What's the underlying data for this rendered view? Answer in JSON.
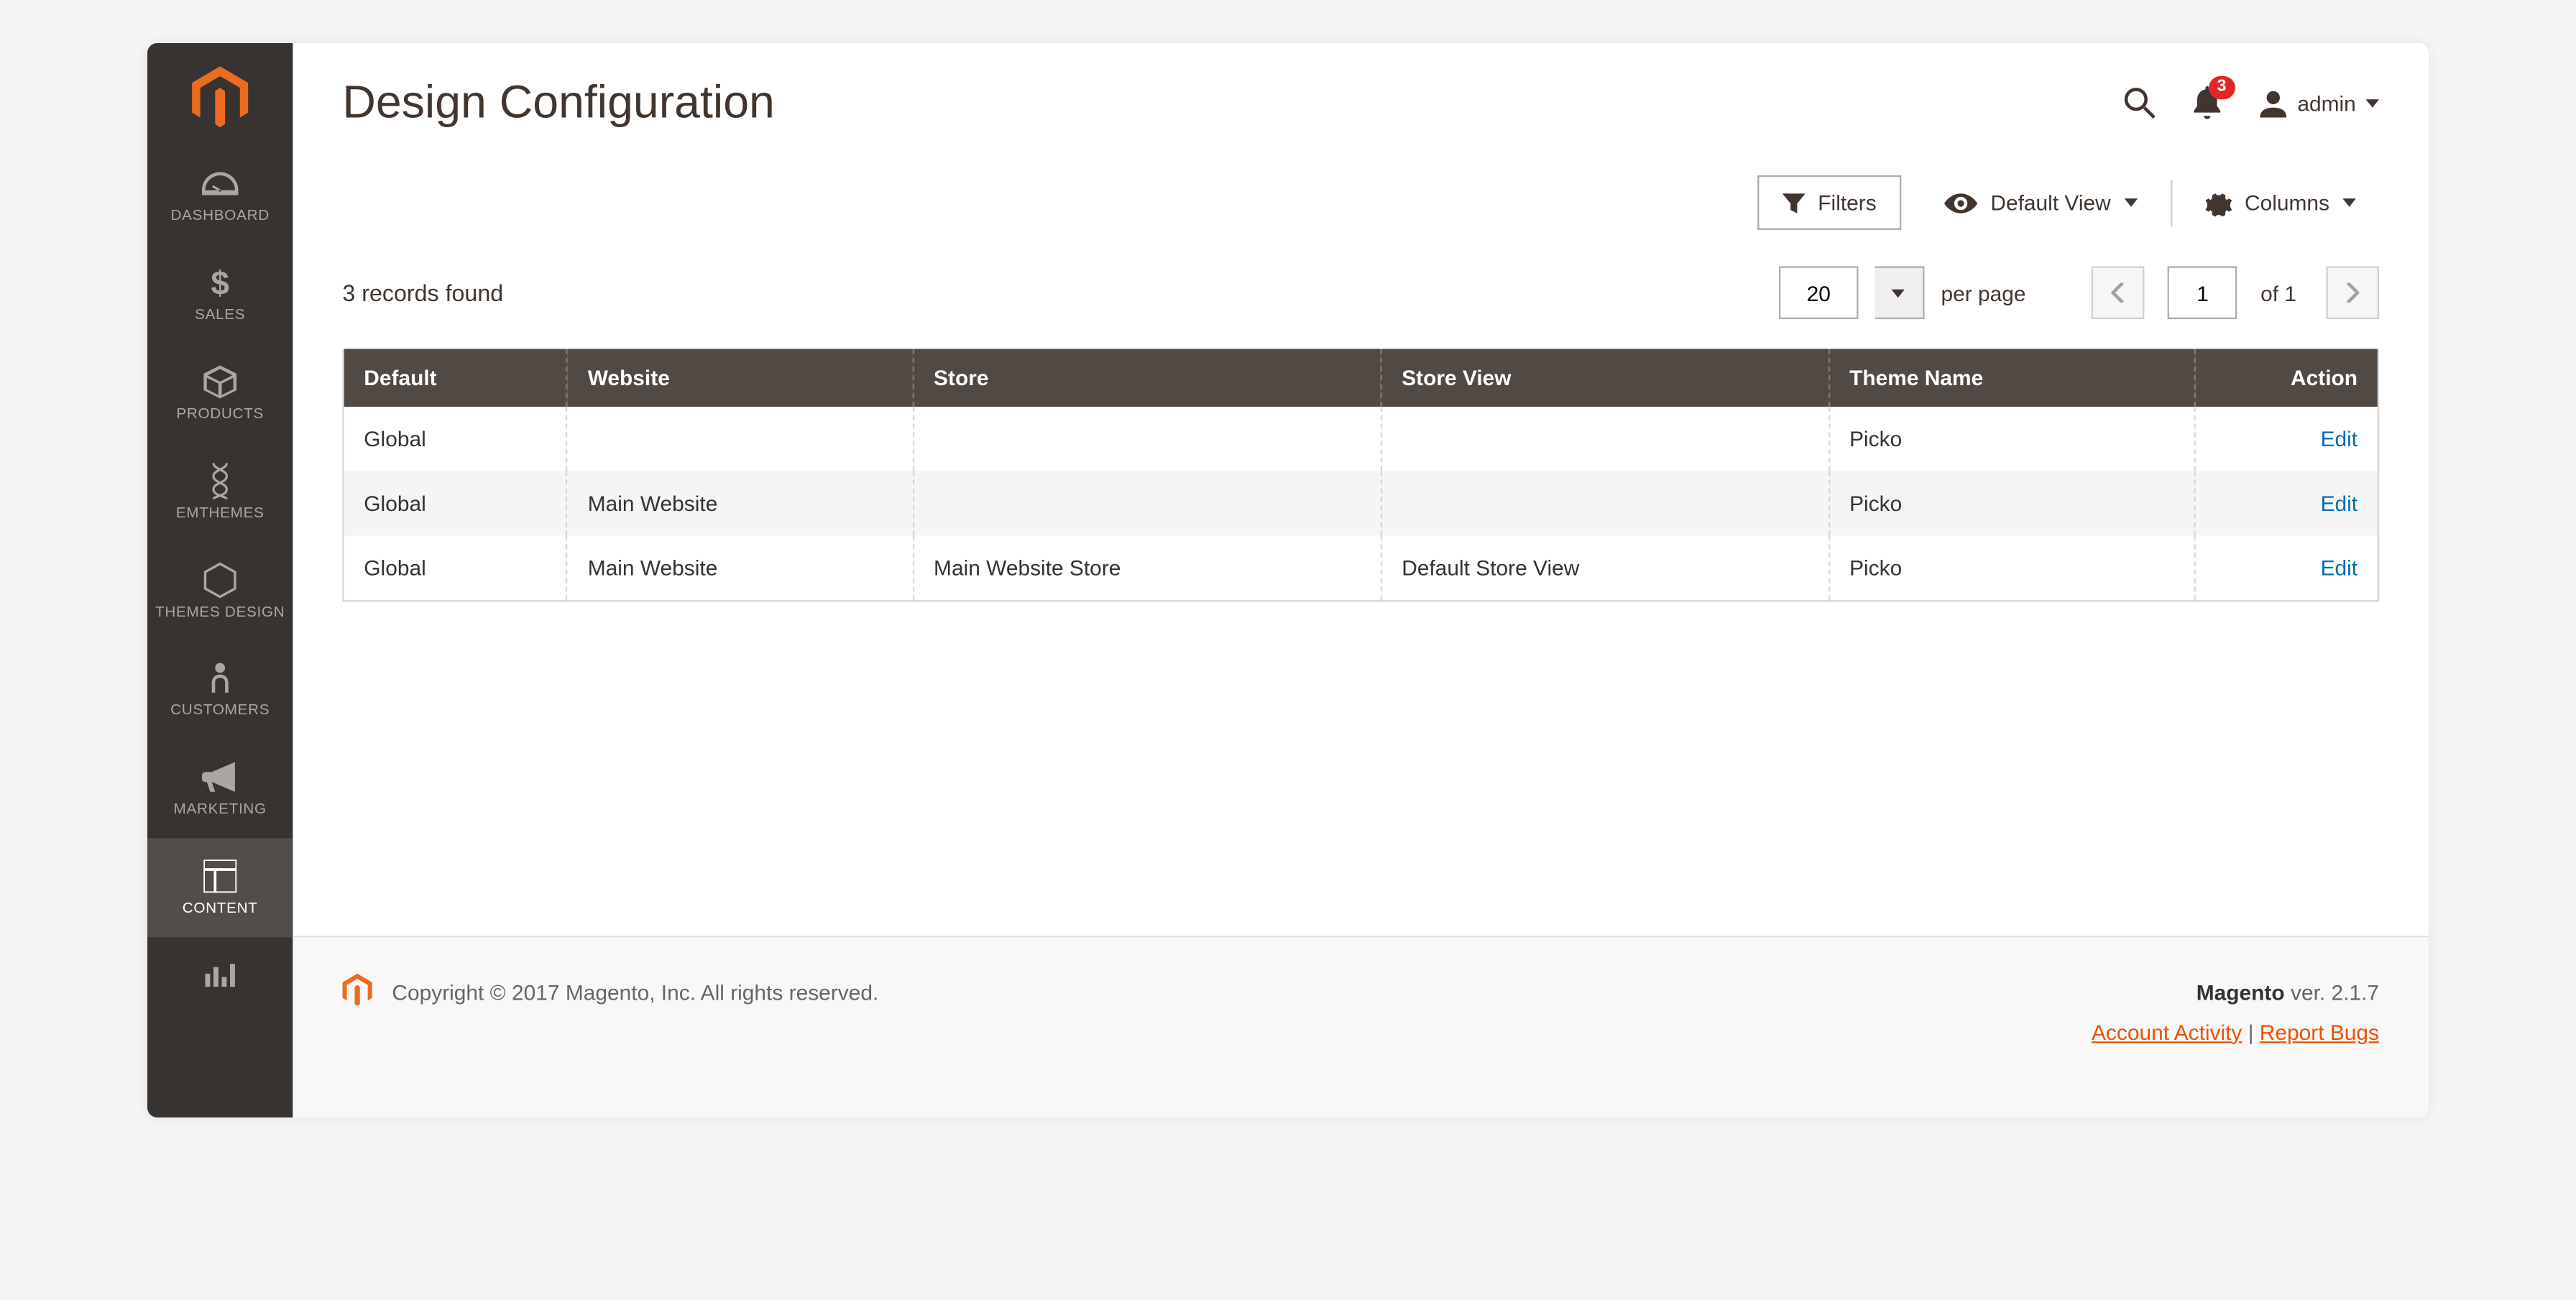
{
  "sidebar": {
    "items": [
      {
        "label": "DASHBOARD"
      },
      {
        "label": "SALES"
      },
      {
        "label": "PRODUCTS"
      },
      {
        "label": "EMTHEMES"
      },
      {
        "label": "THEMES DESIGN"
      },
      {
        "label": "CUSTOMERS"
      },
      {
        "label": "MARKETING"
      },
      {
        "label": "CONTENT"
      }
    ]
  },
  "header": {
    "title": "Design Configuration",
    "notification_count": "3",
    "username": "admin"
  },
  "toolbar": {
    "filters_label": "Filters",
    "default_view_label": "Default View",
    "columns_label": "Columns"
  },
  "records": {
    "found_text": "3 records found",
    "per_page_value": "20",
    "per_page_label": "per page",
    "current_page": "1",
    "of_label": "of 1"
  },
  "table": {
    "columns": [
      "Default",
      "Website",
      "Store",
      "Store View",
      "Theme Name",
      "Action"
    ],
    "rows": [
      {
        "default": "Global",
        "website": "",
        "store": "",
        "store_view": "",
        "theme": "Picko",
        "action": "Edit"
      },
      {
        "default": "Global",
        "website": "Main Website",
        "store": "",
        "store_view": "",
        "theme": "Picko",
        "action": "Edit"
      },
      {
        "default": "Global",
        "website": "Main Website",
        "store": "Main Website Store",
        "store_view": "Default Store View",
        "theme": "Picko",
        "action": "Edit"
      }
    ]
  },
  "footer": {
    "copyright": "Copyright © 2017 Magento, Inc. All rights reserved.",
    "brand": "Magento",
    "version": " ver. 2.1.7",
    "account_activity": "Account Activity",
    "report_bugs": "Report Bugs",
    "sep": " | "
  }
}
